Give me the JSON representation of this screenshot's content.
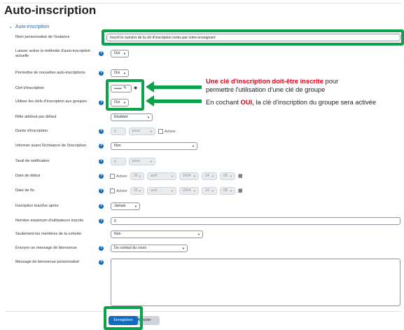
{
  "page": {
    "title": "Auto-inscription"
  },
  "section": {
    "label": "Auto-inscription"
  },
  "fields": {
    "nom_instance": {
      "label": "Nom personnalisé de l'instance",
      "value": "Inscrit le numéro de la clé d'inscription remis par votre enseignant"
    },
    "laisser_active": {
      "label_line1": "Laisser active la méthode d'auto-inscription",
      "label_line2": "actuelle",
      "value": "Oui"
    },
    "permettre_nouvelles": {
      "label": "Permettre de nouvelles auto-inscriptions",
      "value": "Oui"
    },
    "clef": {
      "label": "Clef d'inscription",
      "value": "••••••"
    },
    "clefs_groupes": {
      "label": "Utiliser les clefs d'inscription aux groupes",
      "value": "Oui"
    },
    "role": {
      "label": "Rôle attribué par défaut",
      "value": "Étudiant"
    },
    "duree": {
      "label": "Durée d'inscription",
      "number": "0",
      "unit": "jours",
      "checkbox": "Activer"
    },
    "informer": {
      "label": "Informer avant l'échéance de l'inscription",
      "value": "Non"
    },
    "seuil": {
      "label": "Seuil de notification",
      "number": "0",
      "unit": "jours"
    },
    "date_debut": {
      "label": "Date de début",
      "checkbox": "Activer",
      "day": "25",
      "month": "avril",
      "year": "2024",
      "hour": "14",
      "minute": "08"
    },
    "date_fin": {
      "label": "Date de fin",
      "checkbox": "Activer",
      "day": "25",
      "month": "avril",
      "year": "2024",
      "hour": "14",
      "minute": "08"
    },
    "inactive_apres": {
      "label": "Inscription inactive après",
      "value": "Jamais"
    },
    "max_users": {
      "label": "Nombre maximum d'utilisateurs inscrits",
      "value": "0"
    },
    "cohorte": {
      "label": "Seulement les membres de la cohorte",
      "value": "Non"
    },
    "envoyer_message": {
      "label": "Envoyer un message de bienvenue",
      "value": "Du contact du cours"
    },
    "message_bienvenue": {
      "label": "Message de bienvenue personnalisé",
      "value": ""
    }
  },
  "buttons": {
    "save": "Enregistrer",
    "cancel": "Annuler"
  },
  "annotations": {
    "line1_red": "Une clé d'inscription doit-être inscrite",
    "line1_rest": " pour",
    "line2": "permettre l'utilisation d'une clé de groupe",
    "line3_pre": "En cochant ",
    "line3_red": "OUI",
    "line3_post": ", la clé d'inscription du groupe sera activée"
  },
  "icons": {
    "help": "question-circle-icon",
    "edit": "pencil-icon",
    "reveal": "eye-icon",
    "calendar": "calendar-icon",
    "section_toggle": "chevron-down-icon"
  },
  "colors": {
    "accent": "#0f6cbf",
    "highlight": "#0aa34a",
    "annotation_red": "#e3001b"
  }
}
